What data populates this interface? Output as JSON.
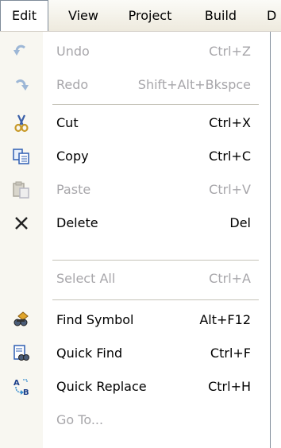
{
  "menubar": {
    "items": [
      "Edit",
      "View",
      "Project",
      "Build",
      "D"
    ]
  },
  "menu": {
    "items": [
      {
        "label": "Undo",
        "shortcut": "Ctrl+Z",
        "icon": "undo-icon",
        "enabled": false
      },
      {
        "label": "Redo",
        "shortcut": "Shift+Alt+Bkspce",
        "icon": "redo-icon",
        "enabled": false
      },
      {
        "label": "Cut",
        "shortcut": "Ctrl+X",
        "icon": "cut-icon",
        "enabled": true
      },
      {
        "label": "Copy",
        "shortcut": "Ctrl+C",
        "icon": "copy-icon",
        "enabled": true
      },
      {
        "label": "Paste",
        "shortcut": "Ctrl+V",
        "icon": "paste-icon",
        "enabled": false
      },
      {
        "label": "Delete",
        "shortcut": "Del",
        "icon": "delete-icon",
        "enabled": true
      },
      {
        "label": "Select All",
        "shortcut": "Ctrl+A",
        "icon": "",
        "enabled": false
      },
      {
        "label": "Find Symbol",
        "shortcut": "Alt+F12",
        "icon": "find-symbol-icon",
        "enabled": true
      },
      {
        "label": "Quick Find",
        "shortcut": "Ctrl+F",
        "icon": "quick-find-icon",
        "enabled": true
      },
      {
        "label": "Quick Replace",
        "shortcut": "Ctrl+H",
        "icon": "quick-replace-icon",
        "enabled": true
      },
      {
        "label": "Go To...",
        "shortcut": "",
        "icon": "",
        "enabled": false
      }
    ]
  },
  "colors": {
    "gutter": "#f8f7f1",
    "disabled_text": "#a7a6aa",
    "separator": "#c5c2b8",
    "border": "#7f8c9a"
  }
}
